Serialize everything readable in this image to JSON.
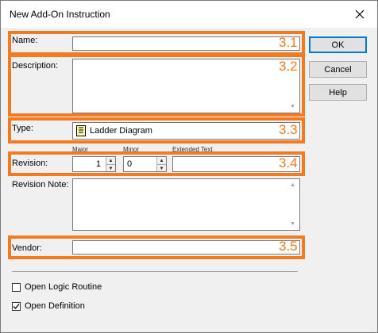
{
  "window": {
    "title": "New Add-On Instruction"
  },
  "labels": {
    "name": "Name:",
    "description": "Description:",
    "type": "Type:",
    "revision": "Revision:",
    "revision_note": "Revision Note:",
    "vendor": "Vendor:",
    "major": "Major",
    "minor": "Minor",
    "extended_text": "Extended Text"
  },
  "fields": {
    "name_value": "",
    "description_value": "",
    "type_value": "Ladder Diagram",
    "major_value": "1",
    "minor_value": "0",
    "extended_text_value": "",
    "revision_note_value": "",
    "vendor_value": ""
  },
  "buttons": {
    "ok": "OK",
    "cancel": "Cancel",
    "help": "Help"
  },
  "annotations": {
    "name": "3.1",
    "description": "3.2",
    "type": "3.3",
    "revision": "3.4",
    "vendor": "3.5"
  },
  "options": {
    "open_logic_routine": {
      "label": "Open Logic Routine",
      "checked": false
    },
    "open_definition": {
      "label": "Open Definition",
      "checked": true
    }
  },
  "colors": {
    "annotation": "#f47a1f",
    "default_button_border": "#0078d7"
  }
}
